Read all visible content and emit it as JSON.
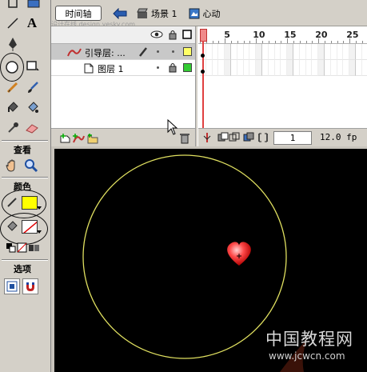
{
  "tools": {
    "view_label": "查看",
    "colors_label": "颜色",
    "options_label": "选项",
    "text_tool_glyph": "A"
  },
  "topbar": {
    "timeline_button": "时间轴",
    "scene_label": "场景 1",
    "symbol_label": "心动",
    "watermark": "设计在线 design.yesky.com"
  },
  "timeline": {
    "layers": [
      {
        "name": "引导层: ...",
        "color": "#ffff66",
        "type": "guide"
      },
      {
        "name": "图层 1",
        "color": "#33cc33",
        "type": "normal"
      }
    ],
    "ruler_numbers": [
      "5",
      "10",
      "15",
      "20",
      "25"
    ],
    "current_frame": "1",
    "frame_rate": "12.0 fp"
  },
  "stage": {
    "background": "#000000",
    "circle_color": "#e0e060",
    "heart_color": "#e03030"
  },
  "site_watermark": {
    "title": "中国教程网",
    "url": "www.jcwcn.com"
  }
}
